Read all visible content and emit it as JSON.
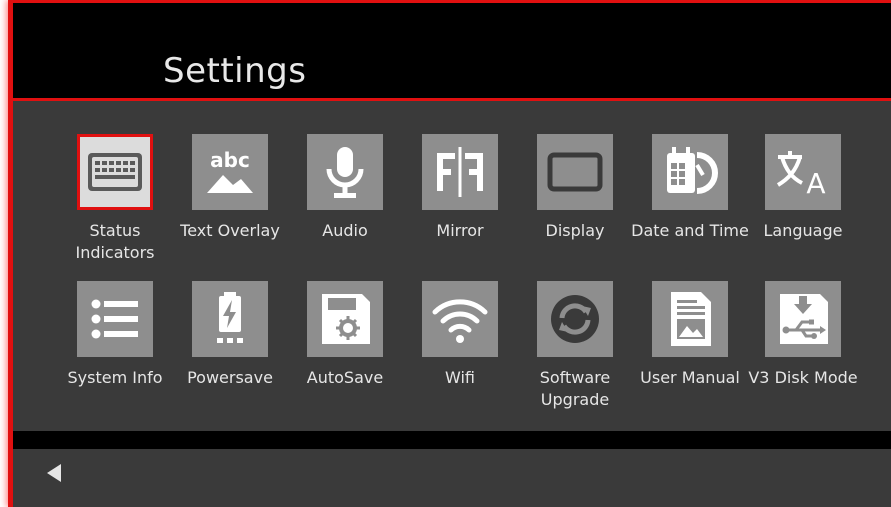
{
  "header": {
    "title": "Settings"
  },
  "tiles": [
    {
      "label": "Status Indicators",
      "icon": "keyboard-icon",
      "selected": true
    },
    {
      "label": "Text Overlay",
      "icon": "text-overlay-icon"
    },
    {
      "label": "Audio",
      "icon": "microphone-icon"
    },
    {
      "label": "Mirror",
      "icon": "mirror-icon"
    },
    {
      "label": "Display",
      "icon": "display-icon"
    },
    {
      "label": "Date and Time",
      "icon": "calendar-clock-icon"
    },
    {
      "label": "Language",
      "icon": "translate-icon"
    },
    {
      "label": "System Info",
      "icon": "list-icon"
    },
    {
      "label": "Powersave",
      "icon": "battery-icon"
    },
    {
      "label": "AutoSave",
      "icon": "floppy-gear-icon"
    },
    {
      "label": "Wifi",
      "icon": "wifi-icon"
    },
    {
      "label": "Software Upgrade",
      "icon": "refresh-icon"
    },
    {
      "label": "User Manual",
      "icon": "document-icon"
    },
    {
      "label": "V3 Disk Mode",
      "icon": "usb-disk-icon"
    }
  ],
  "footer": {
    "back_icon": "back-arrow-icon"
  },
  "colors": {
    "accent": "#e01010",
    "tile": "#8e8e8e",
    "selected_tile": "#dcdcdc",
    "panel": "#3a3a3a"
  }
}
